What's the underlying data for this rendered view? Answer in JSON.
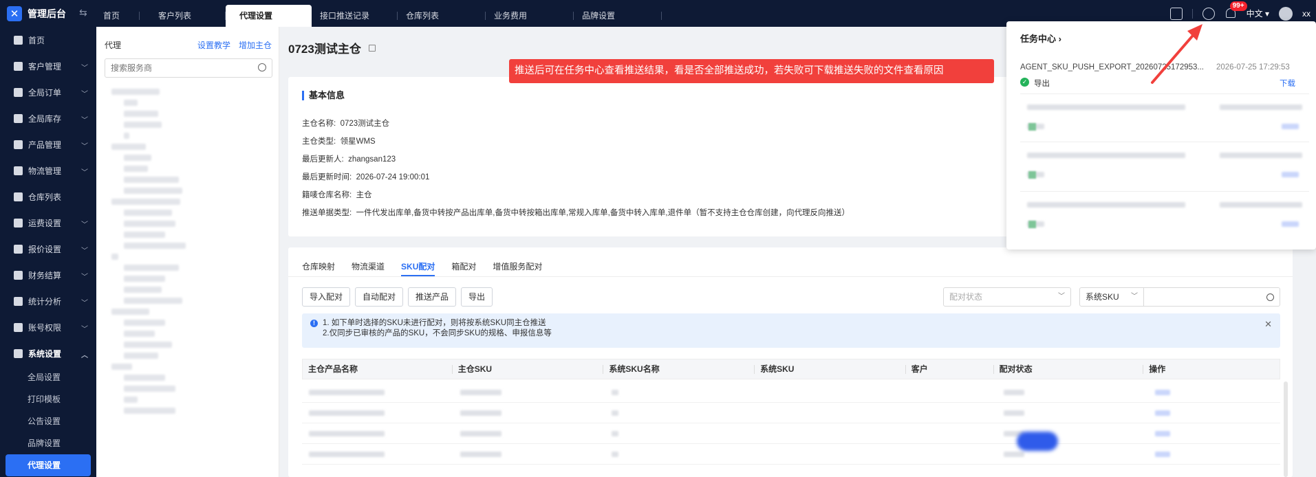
{
  "app": {
    "title": "管理后台"
  },
  "tabs": [
    {
      "label": "首页"
    },
    {
      "label": "客户列表"
    },
    {
      "label": "代理设置",
      "active": true
    },
    {
      "label": "接口推送记录"
    },
    {
      "label": "仓库列表"
    },
    {
      "label": "业务费用"
    },
    {
      "label": "品牌设置"
    }
  ],
  "topbar": {
    "notification_badge": "99+",
    "language": "中文",
    "username": "xx"
  },
  "sidebar": {
    "items": [
      {
        "label": "首页",
        "icon": "home-icon"
      },
      {
        "label": "客户管理",
        "icon": "users-icon"
      },
      {
        "label": "全局订单",
        "icon": "orders-icon"
      },
      {
        "label": "全局库存",
        "icon": "inventory-icon"
      },
      {
        "label": "产品管理",
        "icon": "product-icon"
      },
      {
        "label": "物流管理",
        "icon": "truck-icon"
      },
      {
        "label": "仓库列表",
        "icon": "warehouse-icon"
      },
      {
        "label": "运费设置",
        "icon": "freight-icon"
      },
      {
        "label": "报价设置",
        "icon": "quote-icon"
      },
      {
        "label": "财务结算",
        "icon": "finance-icon"
      },
      {
        "label": "统计分析",
        "icon": "chart-icon"
      },
      {
        "label": "账号权限",
        "icon": "account-icon"
      },
      {
        "label": "系统设置",
        "icon": "gear-icon"
      }
    ],
    "sub_items": [
      {
        "label": "全局设置"
      },
      {
        "label": "打印模板"
      },
      {
        "label": "公告设置"
      },
      {
        "label": "品牌设置"
      },
      {
        "label": "代理设置",
        "active": true
      }
    ]
  },
  "left_panel": {
    "title": "代理",
    "link_tutorial": "设置教学",
    "link_add": "增加主仓",
    "search_placeholder": "搜索服务商"
  },
  "main": {
    "title": "0723测试主仓",
    "basic_info_title": "基本信息",
    "info": [
      {
        "label": "主仓名称:",
        "value": "0723测试主仓"
      },
      {
        "label": "主仓类型:",
        "value": "领星WMS"
      },
      {
        "label": "最后更新人:",
        "value": "zhangsan123"
      },
      {
        "label": "最后更新时间:",
        "value": "2026-07-24 19:00:01"
      },
      {
        "label": "籍唛仓库名称:",
        "value": "主仓"
      },
      {
        "label": "推送单据类型:",
        "value": "一件代发出库单,备货中转按产品出库单,备货中转按箱出库单,常规入库单,备货中转入库单,退件单（暂不支持主仓仓库创建，向代理反向推送）"
      }
    ],
    "subtabs": [
      "仓库映射",
      "物流渠道",
      "SKU配对",
      "箱配对",
      "增值服务配对"
    ],
    "buttons": [
      "导入配对",
      "自动配对",
      "推送产品",
      "导出"
    ],
    "filter_status_placeholder": "配对状态",
    "sku_select": "系统SKU",
    "notice_line1": "1. 如下单时选择的SKU未进行配对，则将按系统SKU同主仓推送",
    "notice_line2": "2.仅同步已审核的产品的SKU，不会同步SKU的规格、申报信息等",
    "columns": [
      "主仓产品名称",
      "主仓SKU",
      "系统SKU名称",
      "系统SKU",
      "客户",
      "配对状态",
      "操作"
    ]
  },
  "annotation": "推送后可在任务中心查看推送结果，看是否全部推送成功，若失败可下载推送失败的文件查看原因",
  "task_center": {
    "title": "任务中心",
    "first_task": {
      "name": "AGENT_SKU_PUSH_EXPORT_20260725172953...",
      "time": "2026-07-25 17:29:53",
      "status": "导出",
      "action": "下载"
    }
  },
  "colors": {
    "accent": "#2b6ff3",
    "sidebar_bg": "#0e1a35",
    "annotation": "#f1403c",
    "success": "#24b35a"
  }
}
